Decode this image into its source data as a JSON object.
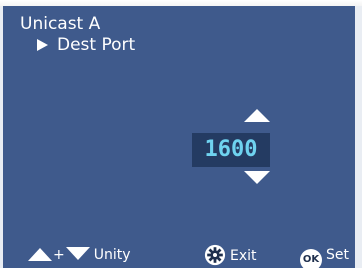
{
  "header": {
    "title": "Unicast A",
    "subtitle": "Dest Port"
  },
  "editor": {
    "value": "1600"
  },
  "footer": {
    "unity_plus": "+",
    "unity_label": "Unity",
    "exit_label": "Exit",
    "ok_icon_text": "OK",
    "set_label": "Set"
  },
  "icons": {
    "increment": "triangle-up-icon",
    "decrement": "triangle-down-icon",
    "exit": "gear-icon",
    "set": "ok-circle-icon",
    "breadcrumb": "triangle-right-icon"
  },
  "colors": {
    "background": "#3f5a8c",
    "value_box": "#243b62",
    "value_text": "#6fd3f0",
    "text": "#ffffff"
  }
}
